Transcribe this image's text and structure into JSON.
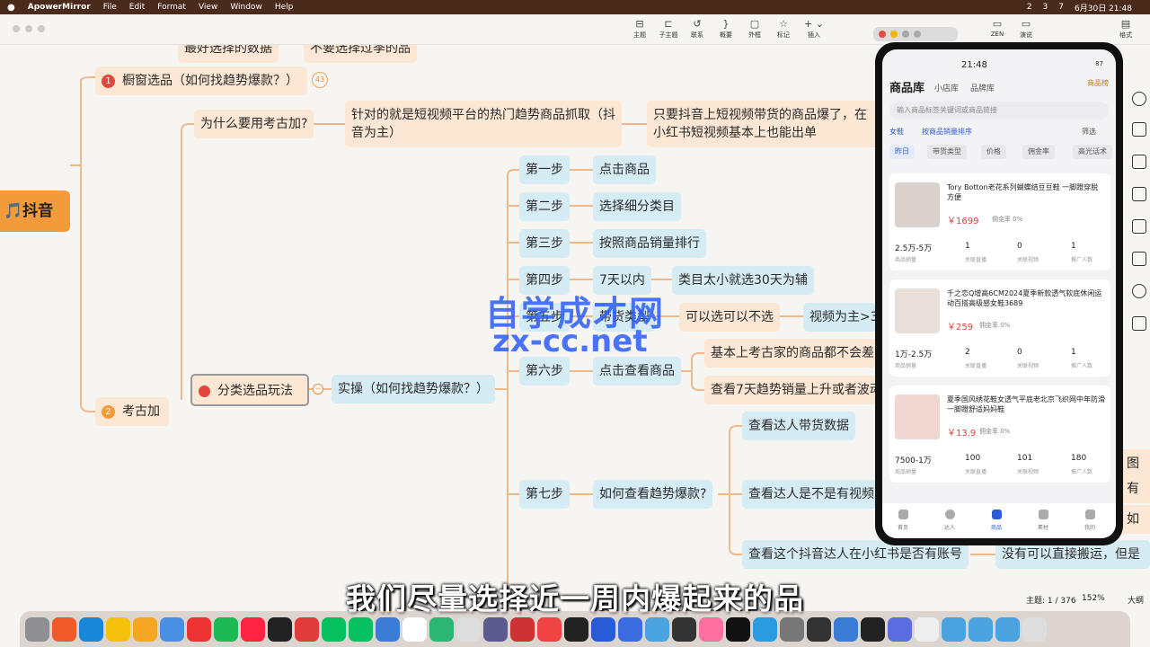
{
  "menubar": {
    "app": "ApowerMirror",
    "items": [
      "File",
      "Edit",
      "Format",
      "View",
      "Window",
      "Help"
    ],
    "right": [
      "2",
      "3",
      "7",
      "6月30日 21:48"
    ]
  },
  "toolbar": {
    "buttons": [
      "主题",
      "子主题",
      "联系",
      "概要",
      "外框",
      "标记",
      "插入"
    ],
    "right_buttons": [
      "ZEN",
      "演说",
      "格式"
    ]
  },
  "mindmap": {
    "top_partial": [
      "最好选择的数据",
      "不要选择过季的品"
    ],
    "root": "🎵抖音",
    "branch1": {
      "num": "1",
      "label": "橱窗选品（如何找趋势爆款？）",
      "count": "43"
    },
    "why": "为什么要用考古加?",
    "why_answer": "针对的就是短视频平台的热门趋势商品抓取（抖音为主）",
    "why_note": "只要抖音上短视频带货的商品爆了，在小红书短视频基本上也能出单",
    "branch2": {
      "num": "2",
      "label": "考古加"
    },
    "category": "分类选品玩法",
    "practice": "实操（如何找趋势爆款？）",
    "steps": [
      {
        "label": "第一步",
        "action": "点击商品"
      },
      {
        "label": "第二步",
        "action": "选择细分类目"
      },
      {
        "label": "第三步",
        "action": "按照商品销量排行"
      },
      {
        "label": "第四步",
        "action": "7天以内",
        "note": "类目太小就选30天为辅"
      },
      {
        "label": "第五步",
        "action": "带货类型",
        "note": "可以选可以不选",
        "note2": "视频为主>3"
      },
      {
        "label": "第六步",
        "action": "点击查看商品",
        "notes": [
          "基本上考古家的商品都不会差",
          "查看7天趋势销量上升或者波动"
        ]
      },
      {
        "label": "第七步",
        "action": "如何查看趋势爆款?",
        "notes": [
          "查看达人带货数据",
          "查看达人是不是有视频",
          "查看这个抖音达人在小红书是否有账号"
        ],
        "deep": "没有可以直接搬运，但是"
      }
    ],
    "edge_fragments": [
      "图文",
      "有",
      "如越"
    ]
  },
  "watermark": {
    "line1": "自学成才网",
    "line2": "zx-cc.net"
  },
  "phone": {
    "time": "21:48",
    "battery": "87",
    "title": "商品库",
    "tabs": [
      "小店库",
      "品牌库"
    ],
    "rank_button": "商品榜",
    "search_placeholder": "输入商品标签关键词或商品链接",
    "filter_category": "女鞋",
    "filter_sort": "按商品销量排序",
    "filter_btn": "筛选",
    "chips": [
      "昨日",
      "带货类型",
      "价格",
      "佣金率",
      "高光话术"
    ],
    "products": [
      {
        "name": "Tory Botton老花系列蝴蝶结豆豆鞋 一脚蹬穿脱方便",
        "price": "￥1699",
        "commission": "佣金率 0%",
        "stats": [
          "2.5万-5万",
          "1",
          "0",
          "1"
        ]
      },
      {
        "name": "千之恋Q增高6CM2024夏季新款透气软底休闲运动百搭高级感女鞋3689",
        "price": "￥259",
        "commission": "佣金率 0%",
        "stats": [
          "1万-2.5万",
          "2",
          "0",
          "1"
        ]
      },
      {
        "name": "夏季国风绣花鞋女透气平底老北京飞织网中年防滑一脚蹬舒适妈妈鞋",
        "price": "￥13.9",
        "commission": "佣金率 0%",
        "stats": [
          "7500-1万",
          "100",
          "101",
          "180"
        ]
      }
    ],
    "stat_labels": [
      "商品销量",
      "关联直播",
      "关联视频",
      "推广人数"
    ],
    "nav": [
      "首页",
      "达人",
      "商品",
      "素材",
      "我的"
    ]
  },
  "status": {
    "topic": "主题: 1 / 376",
    "zoom": "152%",
    "mode": "大纲"
  },
  "subtitle": "我们尽量选择近一周内爆起来的品"
}
